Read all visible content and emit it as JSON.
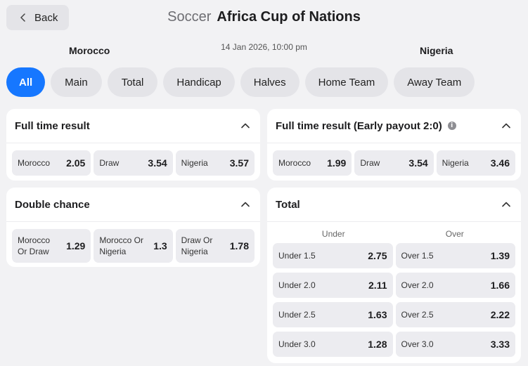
{
  "header": {
    "back_label": "Back",
    "sport": "Soccer",
    "competition": "Africa Cup of Nations"
  },
  "match": {
    "home_team": "Morocco",
    "away_team": "Nigeria",
    "datetime": "14 Jan 2026, 10:00 pm"
  },
  "tabs": [
    {
      "label": "All",
      "active": true
    },
    {
      "label": "Main"
    },
    {
      "label": "Total"
    },
    {
      "label": "Handicap"
    },
    {
      "label": "Halves"
    },
    {
      "label": "Home Team"
    },
    {
      "label": "Away Team"
    }
  ],
  "markets": {
    "full_time": {
      "title": "Full time result",
      "odds": [
        {
          "name": "Morocco",
          "price": "2.05"
        },
        {
          "name": "Draw",
          "price": "3.54"
        },
        {
          "name": "Nigeria",
          "price": "3.57"
        }
      ]
    },
    "full_time_early": {
      "title": "Full time result (Early payout 2:0)",
      "odds": [
        {
          "name": "Morocco",
          "price": "1.99"
        },
        {
          "name": "Draw",
          "price": "3.54"
        },
        {
          "name": "Nigeria",
          "price": "3.46"
        }
      ]
    },
    "double_chance": {
      "title": "Double chance",
      "odds": [
        {
          "name_line1": "Morocco",
          "name_line2": "Or Draw",
          "price": "1.29"
        },
        {
          "name_line1": "Morocco Or",
          "name_line2": "Nigeria",
          "price": "1.3"
        },
        {
          "name_line1": "Draw Or",
          "name_line2": "Nigeria",
          "price": "1.78"
        }
      ]
    },
    "total": {
      "title": "Total",
      "under_header": "Under",
      "over_header": "Over",
      "rows": [
        {
          "under": "Under 1.5",
          "under_price": "2.75",
          "over": "Over 1.5",
          "over_price": "1.39"
        },
        {
          "under": "Under 2.0",
          "under_price": "2.11",
          "over": "Over 2.0",
          "over_price": "1.66"
        },
        {
          "under": "Under 2.5",
          "under_price": "1.63",
          "over": "Over 2.5",
          "over_price": "2.22"
        },
        {
          "under": "Under 3.0",
          "under_price": "1.28",
          "over": "Over 3.0",
          "over_price": "3.33"
        }
      ]
    }
  },
  "colors": {
    "accent": "#1677ff",
    "background": "#f2f2f4",
    "chip": "#e4e4e8",
    "odd_cell": "#ececf0"
  },
  "icons": {
    "back": "chevron-left-icon",
    "collapse": "chevron-up-icon",
    "info": "info-icon"
  }
}
